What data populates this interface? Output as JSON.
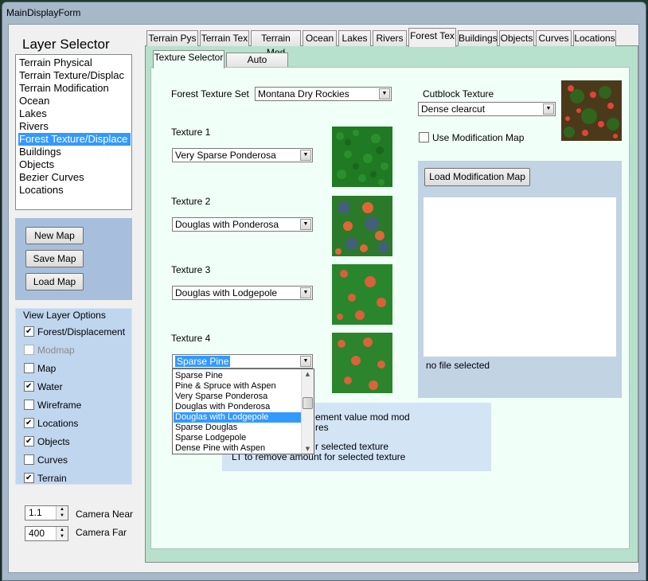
{
  "window": {
    "title": "MainDisplayForm"
  },
  "layer_selector": {
    "title": "Layer Selector",
    "items": [
      "Terrain Physical",
      "Terrain Texture/Displac",
      "Terrain Modification",
      "Ocean",
      "Lakes",
      "Rivers",
      "Forest Texture/Displace",
      "Buildings",
      "Objects",
      "Bezier Curves",
      "Locations"
    ],
    "selected_index": 6
  },
  "map_buttons": {
    "new": "New Map",
    "save": "Save Map",
    "load": "Load Map"
  },
  "view_layer_options": {
    "title": "View Layer Options",
    "items": [
      {
        "label": "Forest/Displacement",
        "checked": true,
        "enabled": true
      },
      {
        "label": "Modmap",
        "checked": false,
        "enabled": false
      },
      {
        "label": "Map",
        "checked": false,
        "enabled": true
      },
      {
        "label": "Water",
        "checked": true,
        "enabled": true
      },
      {
        "label": "Wireframe",
        "checked": false,
        "enabled": true
      },
      {
        "label": "Locations",
        "checked": true,
        "enabled": true
      },
      {
        "label": "Objects",
        "checked": true,
        "enabled": true
      },
      {
        "label": "Curves",
        "checked": false,
        "enabled": true
      },
      {
        "label": "Terrain",
        "checked": true,
        "enabled": true
      }
    ]
  },
  "camera": {
    "near": {
      "value": "1.1",
      "label": "Camera Near"
    },
    "far": {
      "value": "400",
      "label": "Camera Far"
    }
  },
  "tabs": [
    "Terrain Pys",
    "Terrain Tex",
    "Terrain Mod",
    "Ocean",
    "Lakes",
    "Rivers",
    "Forest Tex",
    "Buildings",
    "Objects",
    "Curves",
    "Locations"
  ],
  "active_tab": "Forest Tex",
  "subtabs": [
    "Texture Selector",
    "Auto Generate"
  ],
  "active_subtab": "Texture Selector",
  "forest": {
    "set_label": "Forest Texture Set",
    "set_value": "Montana Dry Rockies",
    "textures": [
      {
        "label": "Texture 1",
        "value": "Very Sparse Ponderosa"
      },
      {
        "label": "Texture 2",
        "value": "Douglas with Ponderosa"
      },
      {
        "label": "Texture 3",
        "value": "Douglas with Lodgepole"
      },
      {
        "label": "Texture 4",
        "value": "Sparse Pine"
      }
    ]
  },
  "cutblock": {
    "label": "Cutblock Texture",
    "value": "Dense clearcut",
    "use_mod_map_label": "Use Modification Map",
    "use_mod_map_checked": false
  },
  "mod_map": {
    "load_button": "Load Modification Map",
    "status": "no file selected"
  },
  "dropdown_options": [
    "Sparse Pine",
    "Pine & Spruce with Aspen",
    "Very Sparse Ponderosa",
    "Douglas with Ponderosa",
    "Douglas with Lodgepole",
    "Sparse Douglas",
    "Sparse Lodgepole",
    "Dense Pine with Aspen"
  ],
  "dropdown_selected_index": 4,
  "help_text": [
    "ement value mod mod",
    "res",
    "r selected texture",
    "LT to remove amount for selected texture"
  ],
  "colors": {
    "selection": "#3399ff",
    "tab_page_bg": "#b7e1cc",
    "panel_blue": "#a7bfdc"
  }
}
